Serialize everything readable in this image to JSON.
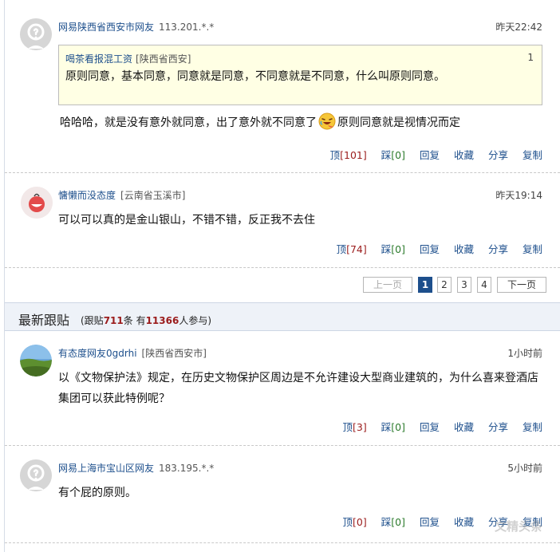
{
  "comments_top": [
    {
      "user": "网易陕西省西安市网友",
      "location": "113.201.*.*",
      "time": "昨天22:42",
      "quote": {
        "user": "喝茶看报混工资",
        "location": "[陕西省西安]",
        "index": "1",
        "text": "原则同意，基本同意，同意就是同意，不同意就是不同意，什么叫原则同意。"
      },
      "text_before": "哈哈哈，就是没有意外就同意，出了意外就不同意了",
      "text_after": "原则同意就是视情况而定",
      "emoji": "laughing-emoji",
      "up": "101",
      "down": "0"
    },
    {
      "user": "慵懒而没态度",
      "location": "[云南省玉溪市]",
      "time": "昨天19:14",
      "text": "可以可以真的是金山银山，不错不错，反正我不去住",
      "up": "74",
      "down": "0"
    }
  ],
  "actions": {
    "up_label": "顶",
    "down_label": "踩",
    "reply": "回复",
    "collect": "收藏",
    "share": "分享",
    "copy": "复制"
  },
  "pager": {
    "prev": "上一页",
    "pages": [
      "1",
      "2",
      "3",
      "4"
    ],
    "current": "1",
    "next": "下一页"
  },
  "latest": {
    "title": "最新跟贴",
    "stats_prefix": "(跟贴",
    "replies": "711",
    "stats_mid": "条 有",
    "participants": "11366",
    "stats_suffix": "人参与)"
  },
  "comments_latest": [
    {
      "user": "有态度网友0gdrhi",
      "location": "[陕西省西安市]",
      "time": "1小时前",
      "line1": "以《文物保护法》规定，在历史文物保护区周边是不允许建设大型商业建筑的，为什么喜来登酒店",
      "line2": "集团可以获此特例呢？",
      "up": "3",
      "down": "0"
    },
    {
      "user": "网易上海市宝山区网友",
      "location": "183.195.*.*",
      "time": "5小时前",
      "text": "有个屁的原则。",
      "up": "0",
      "down": "0"
    }
  ],
  "watermark": "文精头条",
  "colors": {
    "link": "#1d4f8c",
    "count": "#9b1c1c",
    "down_count": "#2d7b2d",
    "quote_bg": "#ffffe4",
    "section_bg": "#eef2f8"
  }
}
